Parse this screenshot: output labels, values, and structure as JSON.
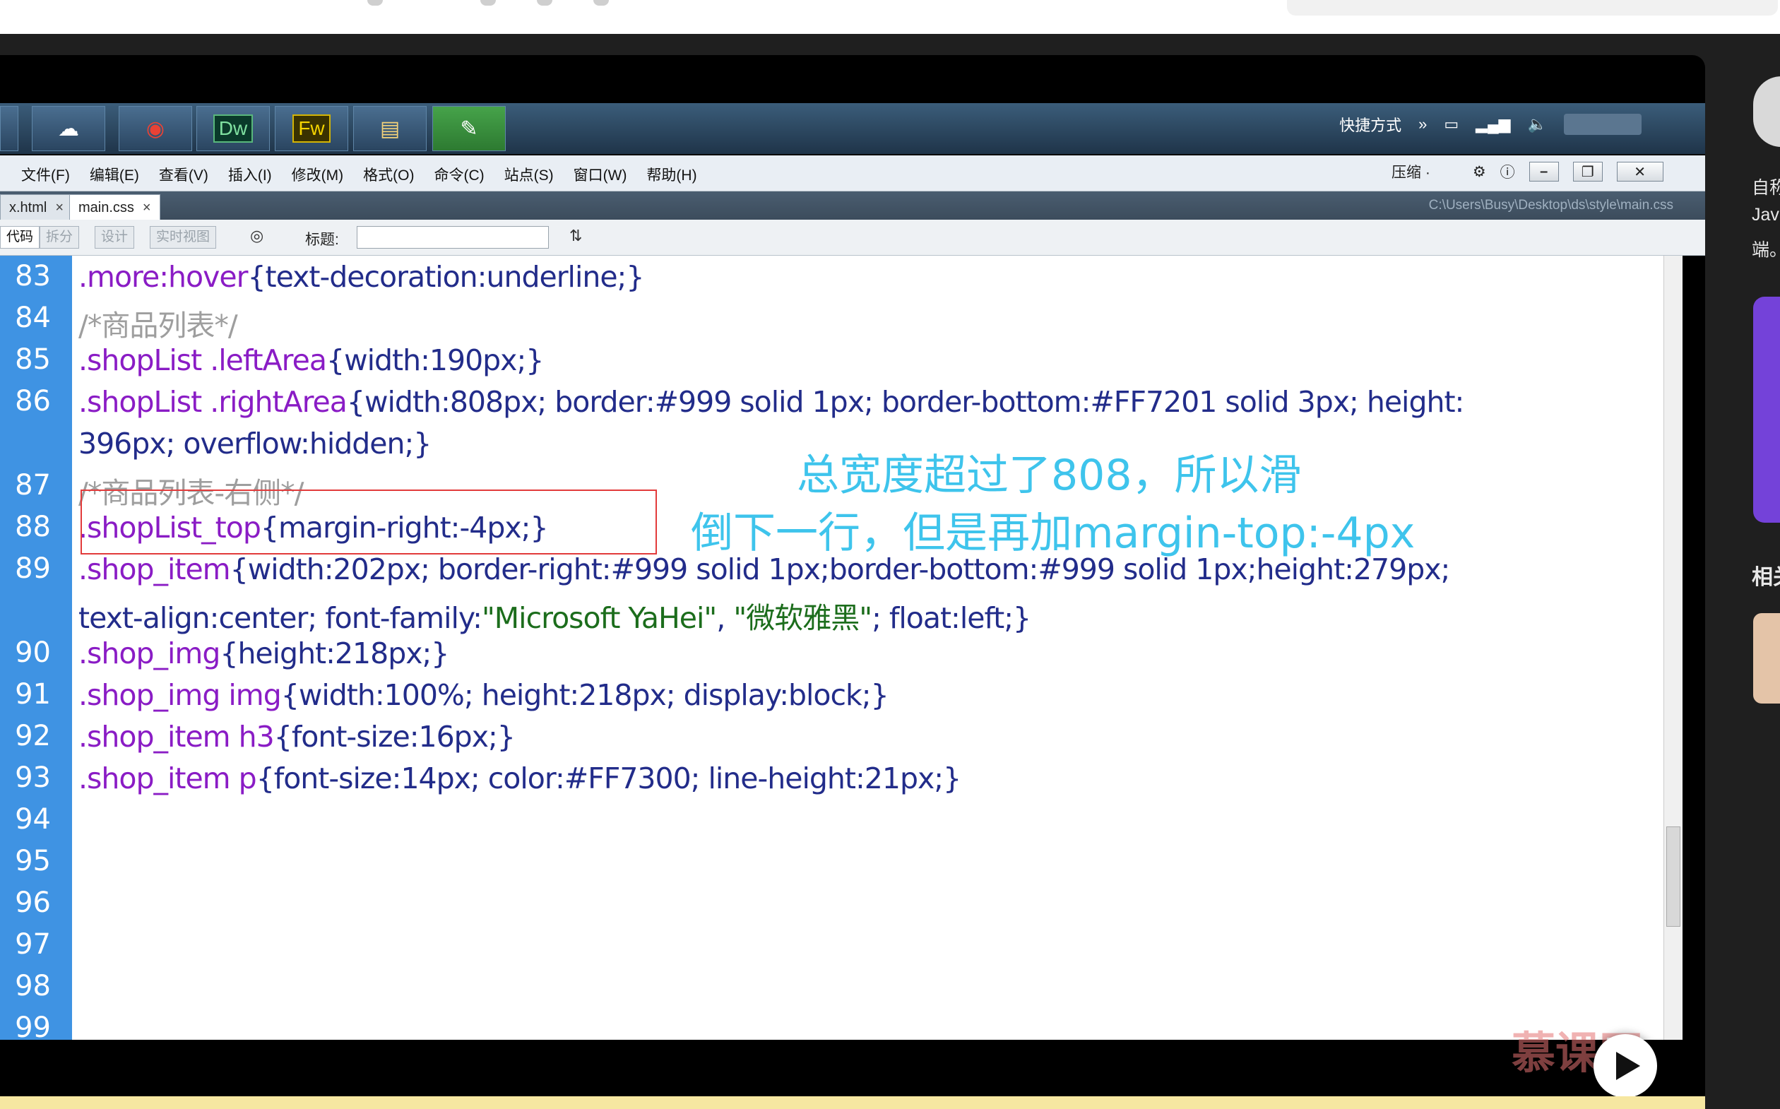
{
  "taskbar": {
    "apps": [
      "start-orb",
      "cloud",
      "chrome",
      "Dw",
      "Fw",
      "explorer",
      "app"
    ],
    "tray_label": "快捷方式"
  },
  "menubar": {
    "items": [
      "文件(F)",
      "编辑(E)",
      "查看(V)",
      "插入(I)",
      "修改(M)",
      "格式(O)",
      "命令(C)",
      "站点(S)",
      "窗口(W)",
      "帮助(H)"
    ],
    "compress": "压缩 ·"
  },
  "tabs": {
    "tab1": "x.html",
    "tab2": "main.css",
    "close": "×",
    "path": "C:\\Users\\Busy\\Desktop\\ds\\style\\main.css"
  },
  "toolbar": {
    "view_code": "代码",
    "view_split": "拆分",
    "view_design": "设计",
    "view_live": "实时视图",
    "title_label": "标题:",
    "title_value": ""
  },
  "editor": {
    "line_numbers": [
      "83",
      "84",
      "85",
      "86",
      "",
      "87",
      "88",
      "89",
      "",
      "90",
      "91",
      "92",
      "93",
      "94",
      "95",
      "96",
      "97",
      "98",
      "99"
    ],
    "lines": [
      {
        "sel": ".more:hover",
        "body": "{text-decoration:underline;}"
      },
      {
        "comment": "/*商品列表*/"
      },
      {
        "sel": ".shopList .leftArea",
        "body": "{width:190px;}"
      },
      {
        "sel": ".shopList .rightArea",
        "body": "{width:808px; border:#999 solid 1px; border-bottom:#FF7201 solid 3px; height:"
      },
      {
        "body": "396px; overflow:hidden;}"
      },
      {
        "comment": "/*商品列表-右侧*/"
      },
      {
        "sel": ".shopList_top",
        "body": "{margin-right:-4px;}"
      },
      {
        "sel": ".shop_item",
        "body": "{width:202px; border-right:#999 solid 1px;border-bottom:#999 solid 1px;height:279px;"
      },
      {
        "body": "text-align:center; font-family:",
        "str1": "\"Microsoft YaHei\"",
        "mid": ", ",
        "str2": "\"微软雅黑\"",
        "tail": "; float:left;}"
      },
      {
        "sel": ".shop_img",
        "body": "{height:218px;}"
      },
      {
        "sel": ".shop_img img",
        "body": "{width:100%; height:218px; display:block;}"
      },
      {
        "sel": ".shop_item h3",
        "body": "{font-size:16px;}"
      },
      {
        "sel": ".shop_item p",
        "body": "{font-size:14px; color:#FF7300; line-height:21px;}"
      }
    ]
  },
  "annotation": {
    "line1": "总宽度超过了808，所以滑",
    "line2": "倒下一行，但是再加margin-top:-4px"
  },
  "watermark": "慕课网",
  "side": {
    "text1": "自称",
    "text2": "Java",
    "text3": "端。",
    "text4": "相关"
  },
  "colors": {
    "gutter": "#3f93e3",
    "annotation": "#3ec4ec",
    "highlight_box": "#e23b3b"
  }
}
